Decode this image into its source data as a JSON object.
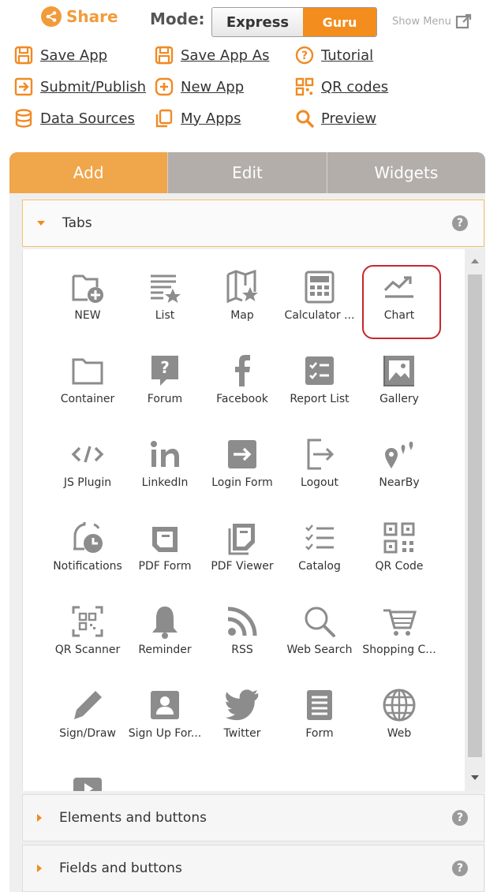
{
  "header": {
    "share_label": "Share",
    "mode_label": "Mode:",
    "mode_options": [
      "Express",
      "Guru"
    ],
    "mode_selected": "Guru",
    "show_menu_label": "Show Menu"
  },
  "toolbar": [
    {
      "label": "Save App",
      "icon": "save-icon"
    },
    {
      "label": "Save App As",
      "icon": "save-as-icon"
    },
    {
      "label": "Tutorial",
      "icon": "question-icon"
    },
    {
      "label": "Submit/Publish",
      "icon": "submit-icon"
    },
    {
      "label": "New App",
      "icon": "plus-icon"
    },
    {
      "label": "QR codes",
      "icon": "qr-icon"
    },
    {
      "label": "Data Sources",
      "icon": "database-icon"
    },
    {
      "label": "My Apps",
      "icon": "copy-icon"
    },
    {
      "label": "Preview",
      "icon": "search-icon"
    }
  ],
  "panel_tabs": [
    "Add",
    "Edit",
    "Widgets"
  ],
  "active_tab": "Add",
  "sections": [
    {
      "label": "Tabs",
      "expanded": true
    },
    {
      "label": "Elements and buttons",
      "expanded": false
    },
    {
      "label": "Fields and buttons",
      "expanded": false
    }
  ],
  "tab_items": [
    {
      "label": "NEW",
      "icon": "folder-plus-icon"
    },
    {
      "label": "List",
      "icon": "list-star-icon"
    },
    {
      "label": "Map",
      "icon": "map-icon"
    },
    {
      "label": "Calculator ...",
      "icon": "calculator-icon"
    },
    {
      "label": "Chart",
      "icon": "chart-icon"
    },
    {
      "label": "Container",
      "icon": "folder-icon"
    },
    {
      "label": "Forum",
      "icon": "forum-icon"
    },
    {
      "label": "Facebook",
      "icon": "facebook-icon"
    },
    {
      "label": "Report List",
      "icon": "report-list-icon"
    },
    {
      "label": "Gallery",
      "icon": "gallery-icon"
    },
    {
      "label": "JS Plugin",
      "icon": "code-icon"
    },
    {
      "label": "LinkedIn",
      "icon": "linkedin-icon"
    },
    {
      "label": "Login Form",
      "icon": "login-icon"
    },
    {
      "label": "Logout",
      "icon": "logout-icon"
    },
    {
      "label": "NearBy",
      "icon": "nearby-icon"
    },
    {
      "label": "Notifications",
      "icon": "notifications-icon"
    },
    {
      "label": "PDF Form",
      "icon": "pdf-form-icon"
    },
    {
      "label": "PDF Viewer",
      "icon": "pdf-viewer-icon"
    },
    {
      "label": "Catalog",
      "icon": "catalog-icon"
    },
    {
      "label": "QR Code",
      "icon": "qr-code-icon"
    },
    {
      "label": "QR Scanner",
      "icon": "qr-scanner-icon"
    },
    {
      "label": "Reminder",
      "icon": "bell-icon"
    },
    {
      "label": "RSS",
      "icon": "rss-icon"
    },
    {
      "label": "Web Search",
      "icon": "search-icon"
    },
    {
      "label": "Shopping C...",
      "icon": "cart-icon"
    },
    {
      "label": "Sign/Draw",
      "icon": "pencil-icon"
    },
    {
      "label": "Sign Up For...",
      "icon": "signup-icon"
    },
    {
      "label": "Twitter",
      "icon": "twitter-icon"
    },
    {
      "label": "Form",
      "icon": "form-icon"
    },
    {
      "label": "Web",
      "icon": "globe-icon"
    },
    {
      "label": "",
      "icon": "video-icon"
    }
  ],
  "highlighted_item": "Chart",
  "colors": {
    "accent": "#f28d1e",
    "tab_active": "#f0a64a",
    "tab_inactive": "#b3aeaa",
    "icon_gray": "#8c8c8c",
    "highlight": "#c9262c"
  }
}
